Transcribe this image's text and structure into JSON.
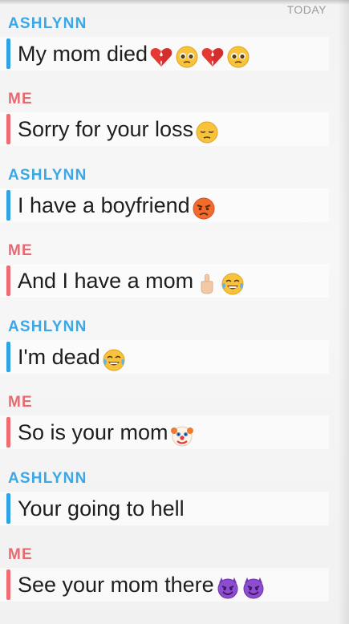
{
  "chat": {
    "date_label": "TODAY",
    "messages": [
      {
        "sender": "ASHLYNN",
        "from": "them",
        "text": "My mom died",
        "emojis": [
          "broken-heart-icon",
          "pleading-face-icon",
          "broken-heart-icon",
          "pleading-face-icon"
        ]
      },
      {
        "sender": "ME",
        "from": "me",
        "text": "Sorry for your loss",
        "emojis": [
          "pensive-face-icon"
        ]
      },
      {
        "sender": "ASHLYNN",
        "from": "them",
        "text": "I have a boyfriend",
        "emojis": [
          "angry-face-icon"
        ]
      },
      {
        "sender": "ME",
        "from": "me",
        "text": "And I have a mom",
        "emojis": [
          "middle-finger-icon",
          "tears-of-joy-icon"
        ]
      },
      {
        "sender": "ASHLYNN",
        "from": "them",
        "text": "I'm dead",
        "emojis": [
          "tears-of-joy-icon"
        ]
      },
      {
        "sender": "ME",
        "from": "me",
        "text": "So is your mom",
        "emojis": [
          "clown-face-icon"
        ]
      },
      {
        "sender": "ASHLYNN",
        "from": "them",
        "text": "Your going to hell",
        "emojis": []
      },
      {
        "sender": "ME",
        "from": "me",
        "text": "See your mom there",
        "emojis": [
          "smiling-devil-icon",
          "smiling-devil-icon"
        ]
      }
    ]
  },
  "colors": {
    "them_accent": "#2fa3e7",
    "me_accent": "#ef6d72",
    "background": "#f3f3f3"
  }
}
